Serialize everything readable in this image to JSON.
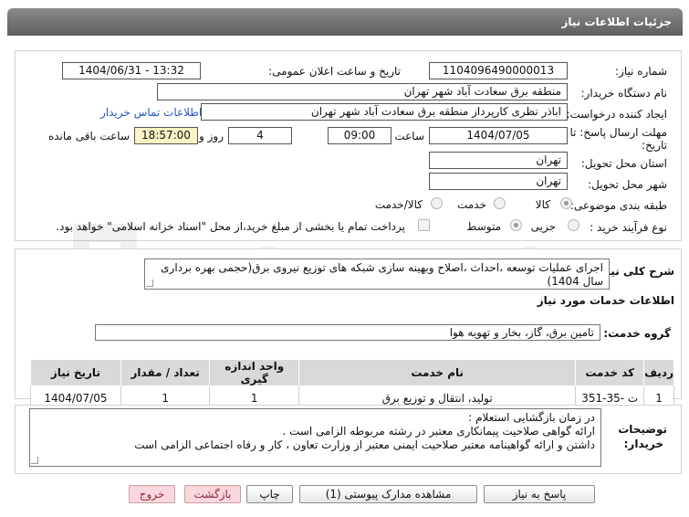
{
  "header": {
    "title": "جزئیات اطلاعات نیاز"
  },
  "form": {
    "need_number_label": "شماره نیاز:",
    "need_number": "1104096490000013",
    "announce_label": "تاریخ و ساعت اعلان عمومی:",
    "announce_value": "1404/06/31 - 13:32",
    "buyer_label": "نام دستگاه خریدار:",
    "buyer_value": "منطقه برق سعادت آباد شهر تهران",
    "creator_label": "ایجاد کننده درخواست:",
    "creator_value": "اباذر نظری کارپرداز منطقه برق سعادت آباد شهر تهران",
    "contact_link": "اطلاعات تماس خریدار",
    "deadline_label_1": "مهلت ارسال پاسخ: تا",
    "deadline_label_2": "تاریخ:",
    "deadline_date": "1404/07/05",
    "time_label": "ساعت",
    "deadline_time": "09:00",
    "days_value": "4",
    "days_label": "روز و",
    "remaining_time": "18:57:00",
    "remaining_label": "ساعت باقی مانده",
    "province_label": "استان محل تحویل:",
    "province_value": "تهران",
    "city_label": "شهر محل تحویل:",
    "city_value": "تهران",
    "category_label": "طبقه بندی موضوعی:",
    "category_options": [
      "کالا",
      "خدمت",
      "کالا/خدمت"
    ],
    "process_label": "نوع فرآیند خرید :",
    "process_options": [
      "جزیی",
      "متوسط"
    ],
    "payment_note": "پرداخت تمام یا بخشی از مبلغ خرید،از محل \"اسناد خزانه اسلامی\" خواهد بود."
  },
  "description": {
    "label": "شرح کلی نیاز:",
    "text": "اجرای عملیات توسعه ،احداث ،اصلاح وبهینه سازی شبکه های توزیع نیروی برق(حجمی بهره برداری سال 1404)"
  },
  "services": {
    "section_title": "اطلاعات خدمات مورد نیاز",
    "group_label": "گروه خدمت:",
    "group_value": "تامین برق، گاز، بخار و تهویه هوا",
    "columns": [
      "ردیف",
      "کد خدمت",
      "نام خدمت",
      "واحد اندازه گیری",
      "تعداد / مقدار",
      "تاریخ نیاز"
    ],
    "rows": [
      [
        "1",
        "ت -35-351",
        "تولید، انتقال و توزیع برق",
        "1",
        "1",
        "1404/07/05"
      ]
    ]
  },
  "buyer_notes": {
    "label_1": "توضیحات",
    "label_2": "خریدار:",
    "lines": [
      "در زمان بازگشایی استعلام :",
      "ارائه گواهی صلاحیت پیمانکاری معتبر در رشته مربوطه الزامی است .",
      "داشتن و ارائه گواهینامه معتبر صلاحیت ایمنی معتبر از وزارت تعاون ، کار و رفاه اجتماعی الزامی است"
    ]
  },
  "buttons": {
    "reply": "پاسخ به نیاز",
    "attachments": "مشاهده مدارک پیوستی (1)",
    "print": "چاپ",
    "back": "بازگشت",
    "exit": "خروج"
  },
  "watermark": {
    "text": "AriaTender.net"
  }
}
